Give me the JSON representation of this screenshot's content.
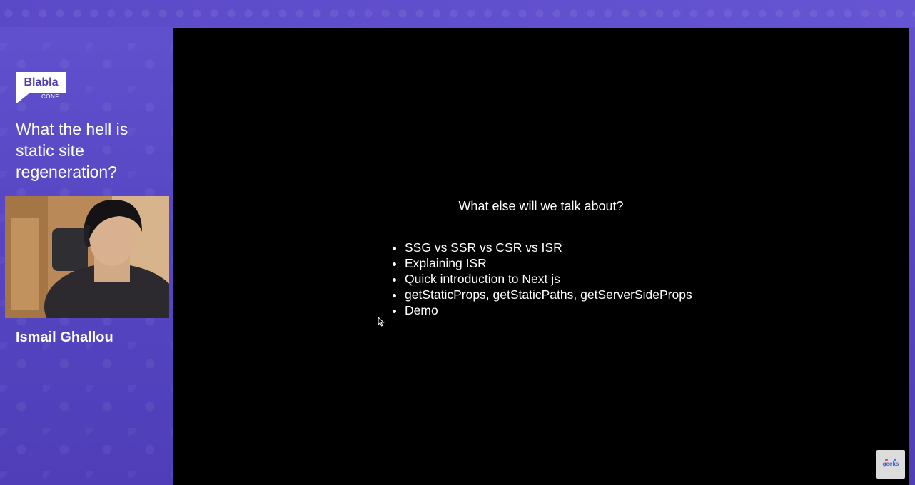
{
  "logo": {
    "name": "Blabla",
    "sub": "CONF"
  },
  "talk": {
    "title": "What the hell is static site regeneration?"
  },
  "speaker": {
    "name": "Ismail Ghallou"
  },
  "slide": {
    "heading": "What else will we talk about?",
    "bullets": [
      "SSG vs SSR vs CSR vs ISR",
      "Explaining ISR",
      "Quick introduction to Next js",
      "getStaticProps, getStaticPaths, getServerSideProps",
      "Demo"
    ]
  },
  "badge": {
    "text": "geeks"
  },
  "colors": {
    "brand": "#5a49c4",
    "slide_bg": "#000000",
    "logo_text": "#4b3ab6"
  }
}
